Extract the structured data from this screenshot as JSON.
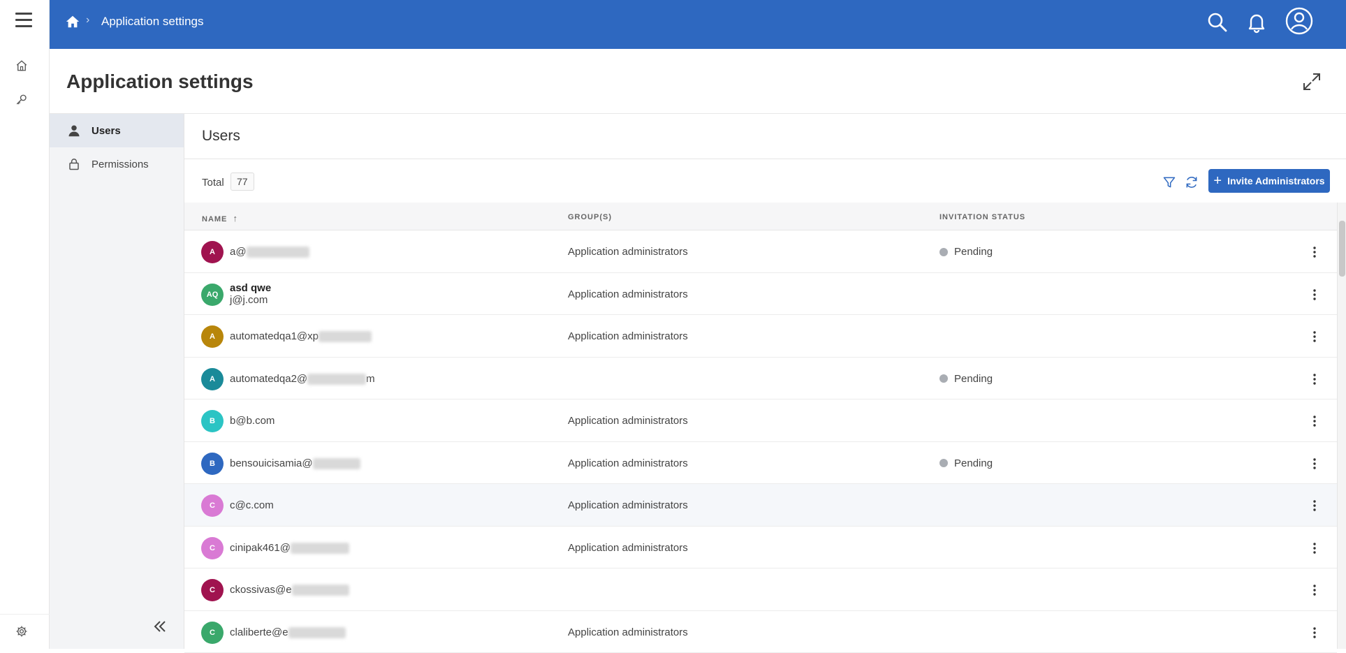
{
  "header": {
    "breadcrumb": "Application settings"
  },
  "page": {
    "title": "Application settings"
  },
  "sidebar": {
    "items": [
      {
        "label": "Users",
        "icon": "user-icon",
        "active": true
      },
      {
        "label": "Permissions",
        "icon": "lock-icon",
        "active": false
      }
    ]
  },
  "section": {
    "title": "Users"
  },
  "toolbar": {
    "total_label": "Total",
    "total_count": "77",
    "invite_label": "Invite Administrators"
  },
  "table": {
    "columns": {
      "name": "NAME",
      "sort_indicator": "↑",
      "groups": "GROUP(S)",
      "status": "INVITATION STATUS"
    },
    "rows": [
      {
        "initials": "A",
        "color": "#a0134f",
        "name": "a@",
        "group": "Application administrators",
        "status": "Pending"
      },
      {
        "initials": "AQ",
        "color": "#3aa86b",
        "name": "asd qwe",
        "email": "j@j.com",
        "group": "Application administrators",
        "status": ""
      },
      {
        "initials": "A",
        "color": "#b8860b",
        "name": "automatedqa1@xp",
        "group": "Application administrators",
        "status": ""
      },
      {
        "initials": "A",
        "color": "#1a8a99",
        "name": "automatedqa2@",
        "name_tail": "m",
        "group": "",
        "status": "Pending"
      },
      {
        "initials": "B",
        "color": "#2bc4c4",
        "name": "b@b.com",
        "group": "Application administrators",
        "status": ""
      },
      {
        "initials": "B",
        "color": "#2e68c0",
        "name": "bensouicisamia@",
        "group": "Application administrators",
        "status": "Pending"
      },
      {
        "initials": "C",
        "color": "#d97ad4",
        "name": "c@c.com",
        "group": "Application administrators",
        "status": ""
      },
      {
        "initials": "C",
        "color": "#d97ad4",
        "name": "cinipak461@",
        "group": "Application administrators",
        "status": ""
      },
      {
        "initials": "C",
        "color": "#a0134f",
        "name": "ckossivas@e",
        "group": "",
        "status": ""
      },
      {
        "initials": "C",
        "color": "#3aa86b",
        "name": "claliberte@e",
        "group": "Application administrators",
        "status": ""
      }
    ]
  }
}
